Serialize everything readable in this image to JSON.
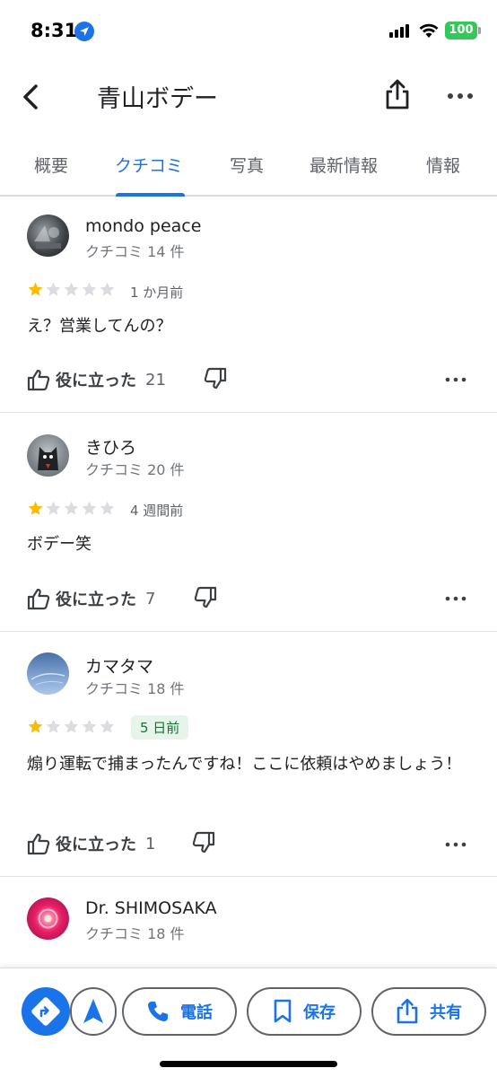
{
  "status_bar": {
    "time": "8:31",
    "battery": "100"
  },
  "header": {
    "title": "青山ボデー"
  },
  "tabs": [
    {
      "label": "概要",
      "active": false
    },
    {
      "label": "クチコミ",
      "active": true
    },
    {
      "label": "写真",
      "active": false
    },
    {
      "label": "最新情報",
      "active": false
    },
    {
      "label": "情報",
      "active": false
    }
  ],
  "reviews": [
    {
      "name": "mondo peace",
      "count": "クチコミ 14 件",
      "rating": 1,
      "date": "1 か月前",
      "text": "え？営業してんの？",
      "helpful_label": "役に立った",
      "helpful_count": "21"
    },
    {
      "name": "きひろ",
      "count": "クチコミ 20 件",
      "rating": 1,
      "date": "4 週間前",
      "text": "ボデー笑",
      "helpful_label": "役に立った",
      "helpful_count": "7"
    },
    {
      "name": "カマタマ",
      "count": "クチコミ 18 件",
      "rating": 1,
      "date": "5 日前",
      "date_highlight": true,
      "text": "煽り運転で捕まったんですね！ここに依頼はやめましょう！",
      "helpful_label": "役に立った",
      "helpful_count": "1"
    },
    {
      "name": "Dr. SHIMOSAKA",
      "count": "クチコミ 18 件"
    }
  ],
  "bottom_bar": {
    "call_label": "電話",
    "save_label": "保存",
    "share_label": "共有"
  },
  "colors": {
    "accent": "#1a73e8",
    "star": "#fbbc04",
    "star_empty": "#dadce0",
    "badge_bg": "#e6f4ea",
    "badge_text": "#137333"
  },
  "icons": [
    "back-arrow-icon",
    "share-icon",
    "more-icon",
    "thumbs-up-icon",
    "thumbs-down-icon",
    "directions-icon",
    "navigate-icon",
    "phone-icon",
    "bookmark-icon"
  ]
}
